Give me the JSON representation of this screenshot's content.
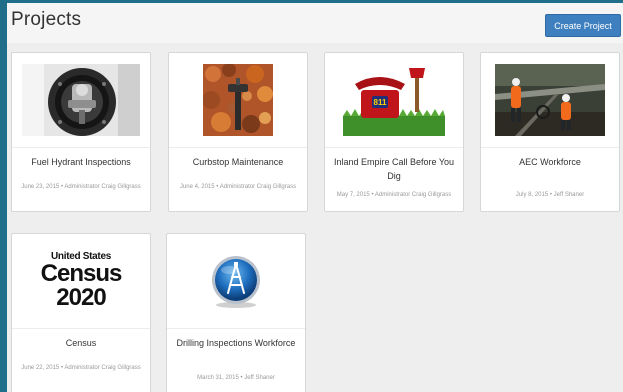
{
  "header": {
    "title": "Projects",
    "create_button_label": "Create Project"
  },
  "projects": [
    {
      "title": "Fuel Hydrant Inspections",
      "date": "June 23, 2015",
      "separator": "•",
      "author": "Administrator Craig Gillgrass",
      "image": "fuel-hydrant-photo"
    },
    {
      "title": "Curbstop Maintenance",
      "date": "June 4, 2015",
      "separator": "•",
      "author": "Administrator Craig Gillgrass",
      "image": "curbstop-photo"
    },
    {
      "title": "Inland Empire Call Before You Dig",
      "date": "May 7, 2015",
      "separator": "•",
      "author": "Administrator Craig Gillgrass",
      "image": "811-call-before-you-dig-photo",
      "image_text": "811"
    },
    {
      "title": "AEC Workforce",
      "date": "July 8, 2015",
      "separator": "•",
      "author": "Jeff Shaner",
      "image": "aec-workers-photo"
    },
    {
      "title": "Census",
      "date": "June 22, 2015",
      "separator": "•",
      "author": "Administrator Craig Gillgrass",
      "image": "census-2020-logo",
      "logo_lines": [
        "United States",
        "Census",
        "2020"
      ]
    },
    {
      "title": "Drilling Inspections Workforce",
      "date": "March 31, 2015",
      "separator": "•",
      "author": "Jeff Shaner",
      "image": "drilling-rig-icon"
    }
  ],
  "colors": {
    "page_background": "#1f6f8b",
    "panel_background": "#eeeeee",
    "button": "#3d7fbf"
  }
}
